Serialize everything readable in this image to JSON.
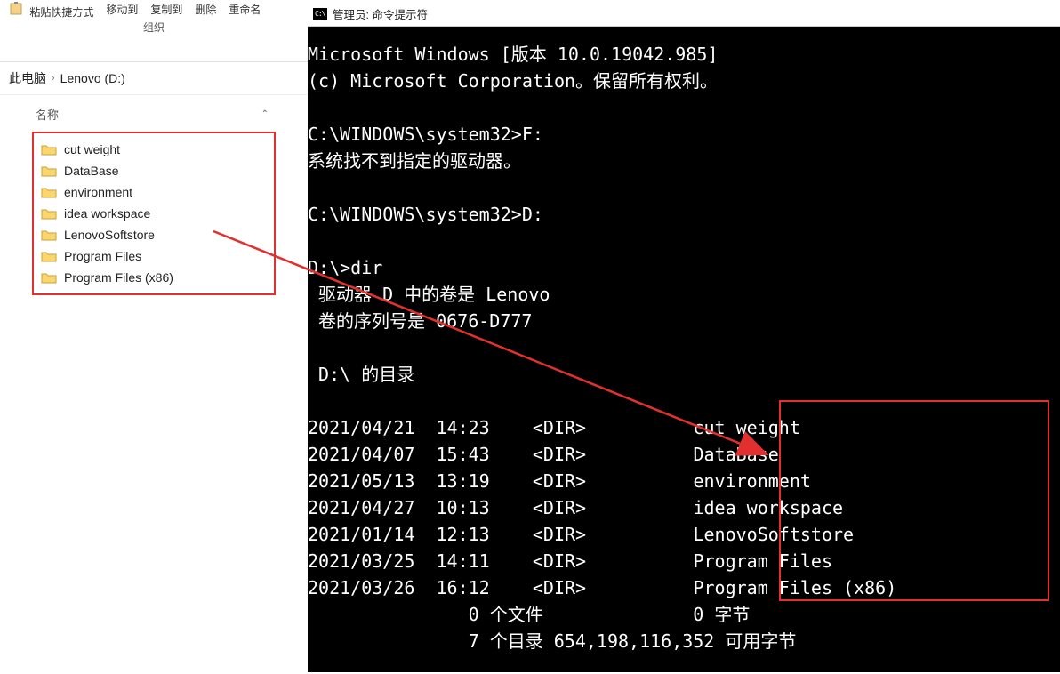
{
  "explorer": {
    "ribbon": {
      "items": [
        "粘贴快捷方式",
        "移动到",
        "复制到",
        "删除",
        "重命名"
      ],
      "group": "组织"
    },
    "breadcrumb": [
      "此电脑",
      "Lenovo (D:)"
    ],
    "column_header": "名称",
    "folders": [
      "cut weight",
      "DataBase",
      "environment",
      "idea workspace",
      "LenovoSoftstore",
      "Program Files",
      "Program Files (x86)"
    ]
  },
  "cmd": {
    "title": "管理员: 命令提示符",
    "icon_label": "C:\\",
    "lines": [
      "Microsoft Windows [版本 10.0.19042.985]",
      "(c) Microsoft Corporation。保留所有权利。",
      "",
      "C:\\WINDOWS\\system32>F:",
      "系统找不到指定的驱动器。",
      "",
      "C:\\WINDOWS\\system32>D:",
      "",
      "D:\\>dir",
      " 驱动器 D 中的卷是 Lenovo",
      " 卷的序列号是 0676-D777",
      "",
      " D:\\ 的目录",
      "",
      "2021/04/21  14:23    <DIR>          cut weight",
      "2021/04/07  15:43    <DIR>          DataBase",
      "2021/05/13  13:19    <DIR>          environment",
      "2021/04/27  10:13    <DIR>          idea workspace",
      "2021/01/14  12:13    <DIR>          LenovoSoftstore",
      "2021/03/25  14:11    <DIR>          Program Files",
      "2021/03/26  16:12    <DIR>          Program Files (x86)",
      "               0 个文件              0 字节",
      "               7 个目录 654,198,116,352 可用字节"
    ]
  }
}
